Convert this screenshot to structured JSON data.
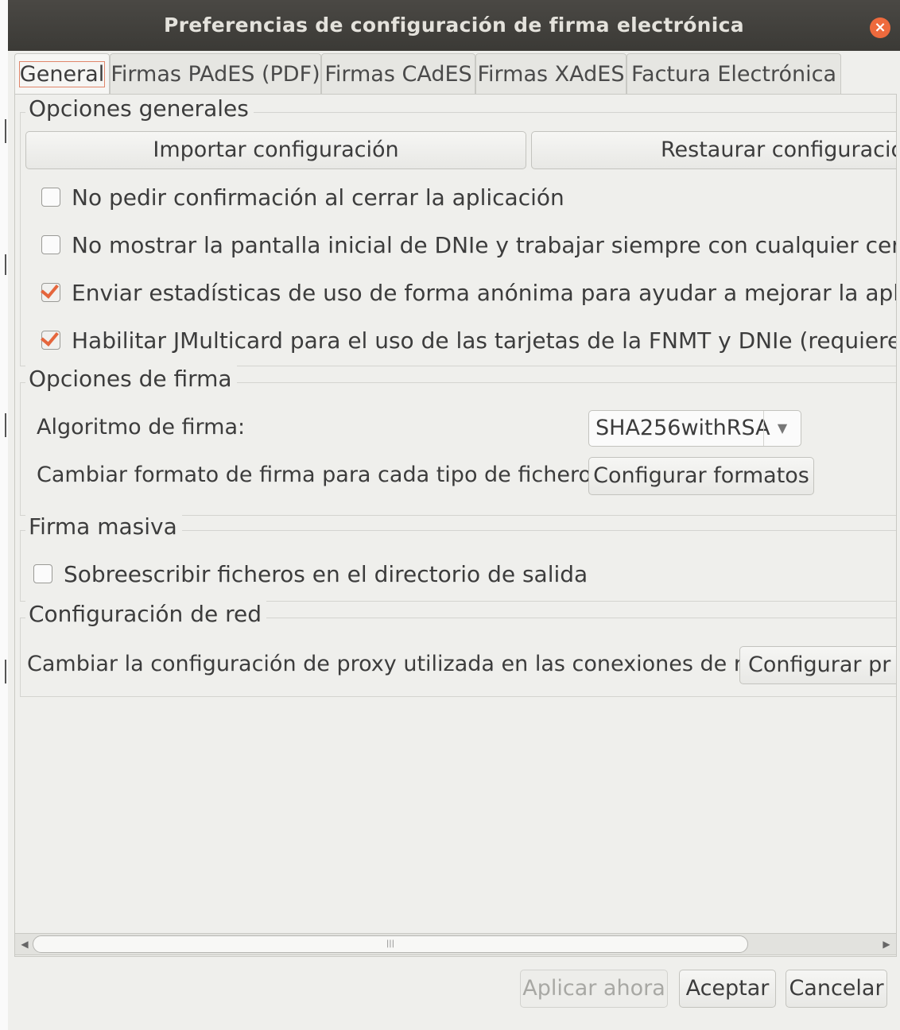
{
  "window": {
    "title": "Preferencias de configuración de firma electrónica",
    "close_icon": "close-icon"
  },
  "tabs": [
    {
      "label": "General",
      "active": true
    },
    {
      "label": "Firmas PAdES (PDF)",
      "active": false
    },
    {
      "label": "Firmas CAdES",
      "active": false
    },
    {
      "label": "Firmas XAdES",
      "active": false
    },
    {
      "label": "Factura Electrónica",
      "active": false
    }
  ],
  "general_options": {
    "legend": "Opciones generales",
    "import_button": "Importar configuración",
    "restore_button": "Restaurar configuració",
    "checkboxes": [
      {
        "label": "No pedir confirmación al cerrar la aplicación",
        "checked": false
      },
      {
        "label": "No mostrar la pantalla inicial de DNIe y trabajar siempre con cualquier certificado",
        "checked": false
      },
      {
        "label": "Enviar estadísticas de uso de forma anónima para ayudar a mejorar la aplicación",
        "checked": true
      },
      {
        "label": "Habilitar JMulticard para el uso de las tarjetas de la FNMT y DNIe (requiere reinici",
        "checked": true
      }
    ]
  },
  "signature_options": {
    "legend": "Opciones de firma",
    "algorithm_label": "Algoritmo de firma:",
    "algorithm_value": "SHA256withRSA",
    "format_label": "Cambiar formato de firma para cada tipo de fichero:",
    "format_button": "Configurar formatos"
  },
  "bulk_signature": {
    "legend": "Firma masiva",
    "overwrite_label": "Sobreescribir ficheros en el directorio de salida",
    "overwrite_checked": false
  },
  "network": {
    "legend": "Configuración de red",
    "proxy_label": "Cambiar la configuración de proxy utilizada en las conexiones de red:",
    "proxy_button": "Configurar pr"
  },
  "footer": {
    "apply_now": "Aplicar ahora",
    "accept": "Aceptar",
    "cancel": "Cancelar"
  },
  "colors": {
    "titlebar": "#3b3a36",
    "close_button": "#ee6a3d",
    "checkbox_accent": "#e5663d"
  }
}
